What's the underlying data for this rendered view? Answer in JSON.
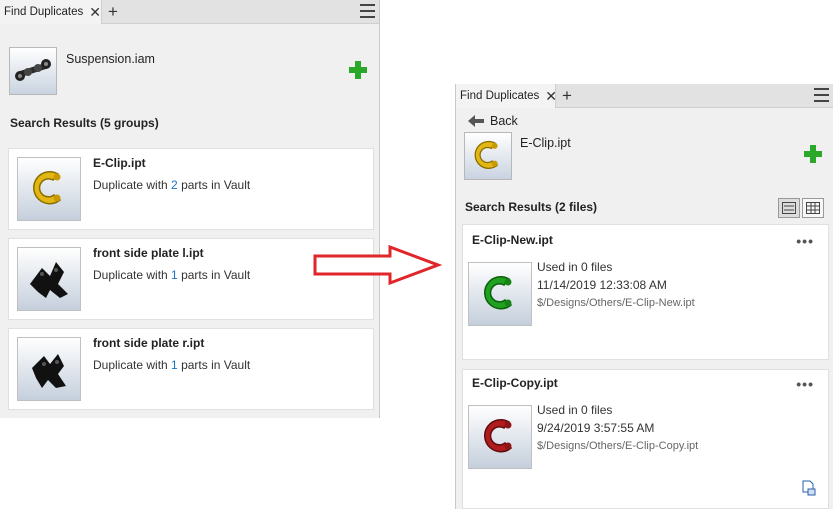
{
  "left_panel": {
    "tab": {
      "label": "Find Duplicates",
      "close": "✕",
      "add": "+"
    },
    "document": {
      "name": "Suspension.iam"
    },
    "section_title": "Search Results (5 groups)",
    "results": [
      {
        "name": "E-Clip.ipt",
        "prefix": "Duplicate with ",
        "count": "2",
        "suffix": " parts in Vault",
        "thumb": "clip-yellow"
      },
      {
        "name": "front side plate l.ipt",
        "prefix": "Duplicate with ",
        "count": "1",
        "suffix": " parts in Vault",
        "thumb": "plate-black"
      },
      {
        "name": "front side plate r.ipt",
        "prefix": "Duplicate with ",
        "count": "1",
        "suffix": " parts in Vault",
        "thumb": "plate-black"
      }
    ]
  },
  "right_panel": {
    "tab": {
      "label": "Find Duplicates",
      "close": "✕",
      "add": "+"
    },
    "back_label": "Back",
    "document": {
      "name": "E-Clip.ipt"
    },
    "section_title": "Search Results (2 files)",
    "files": [
      {
        "name": "E-Clip-New.ipt",
        "usage": "Used in 0 files",
        "date": "11/14/2019 12:33:08 AM",
        "path": "$/Designs/Others/E-Clip-New.ipt",
        "more": "•••",
        "thumb_color": "#1fa21f"
      },
      {
        "name": "E-Clip-Copy.ipt",
        "usage": "Used in 0 files",
        "date": "9/24/2019 3:57:55 AM",
        "path": "$/Designs/Others/E-Clip-Copy.ipt",
        "more": "•••",
        "thumb_color": "#b01c1c"
      }
    ]
  },
  "colors": {
    "add_green": "#2aa82a",
    "arrow_red": "#e0262a",
    "link_blue": "#1a73c8",
    "clip_yellow": "#e2b714"
  }
}
